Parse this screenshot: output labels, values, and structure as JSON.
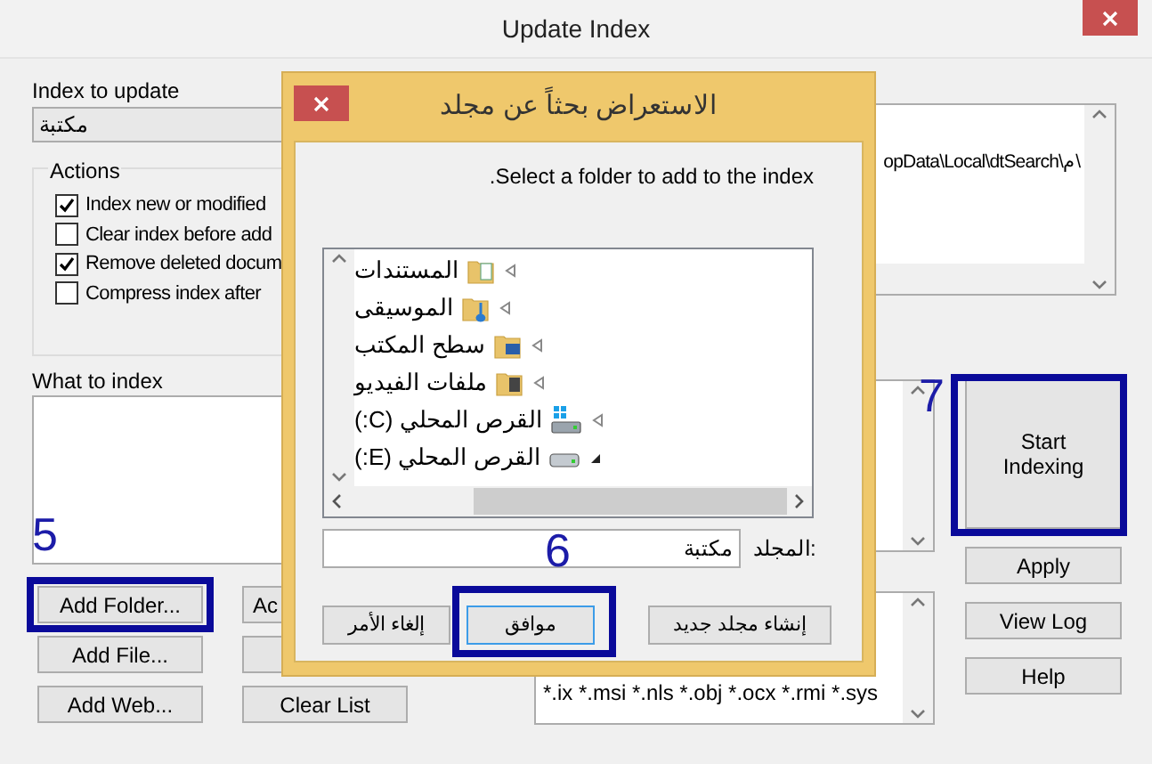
{
  "window": {
    "title": "Update Index"
  },
  "index_to_update": {
    "label": "Index to update",
    "value": "مكتبة"
  },
  "actions": {
    "title": "Actions",
    "options": [
      {
        "label": "Index new or modified",
        "checked": true
      },
      {
        "label": "Clear index before add",
        "checked": false
      },
      {
        "label": "Remove deleted docum",
        "checked": true
      },
      {
        "label": "Compress index after",
        "checked": false
      }
    ]
  },
  "what_to_index": {
    "label": "What to index"
  },
  "left_buttons": [
    {
      "label": "Add Folder..."
    },
    {
      "label": "Add File..."
    },
    {
      "label": "Add Web..."
    },
    {
      "label": "Ac"
    },
    {
      "label": "Clear List"
    }
  ],
  "index_information": {
    "path": "opData\\Local\\dtSearch\\م\\"
  },
  "file_types": {
    "text": "*.ix *.msi *.nls *.obj *.ocx *.rmi *.sys"
  },
  "right_buttons": [
    {
      "label": "Start Indexing",
      "kind": "large"
    },
    {
      "label": "Apply",
      "kind": "normal"
    },
    {
      "label": "View Log",
      "kind": "normal"
    },
    {
      "label": "Help",
      "kind": "normal"
    }
  ],
  "annotations": [
    {
      "text": "5"
    },
    {
      "text": "6"
    },
    {
      "text": "7"
    }
  ],
  "dialog": {
    "title": "الاستعراض بحثاً عن مجلد",
    "prompt": ".Select a folder to add to the index",
    "tree": [
      {
        "label": "المستندات",
        "kind": "documents",
        "expanded": false
      },
      {
        "label": "الموسيقى",
        "kind": "music",
        "expanded": false
      },
      {
        "label": "سطح المكتب",
        "kind": "desktop",
        "expanded": false
      },
      {
        "label": "ملفات الفيديو",
        "kind": "videos",
        "expanded": false
      },
      {
        "label": "القرص المحلي (C:)",
        "kind": "system-drive",
        "expanded": false
      },
      {
        "label": "القرص المحلي (E:)",
        "kind": "drive",
        "expanded": true
      }
    ],
    "folder": {
      "label": "المجلد:",
      "value": "مكتبة"
    },
    "buttons": [
      {
        "label": "إنشاء مجلد جديد",
        "default": false
      },
      {
        "label": "موافق",
        "default": true
      },
      {
        "label": "إلغاء الأمر",
        "default": false
      }
    ]
  }
}
